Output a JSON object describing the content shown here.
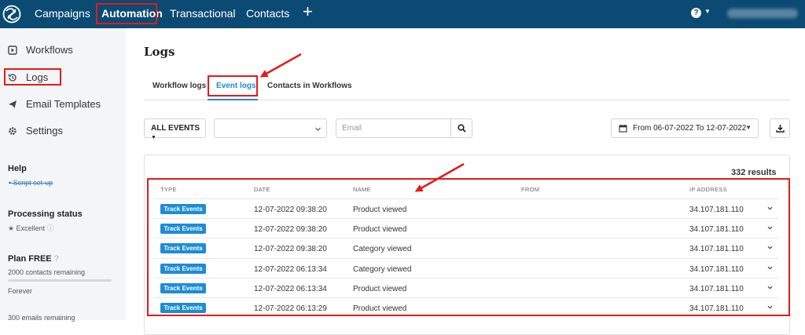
{
  "topnav": {
    "items": [
      {
        "label": "Campaigns",
        "active": false
      },
      {
        "label": "Automation",
        "active": true
      },
      {
        "label": "Transactional",
        "active": false
      },
      {
        "label": "Contacts",
        "active": false
      }
    ],
    "add_icon": "plus-icon",
    "help_icon": "?"
  },
  "sidebar": {
    "items": [
      {
        "label": "Workflows",
        "icon": "play-square-icon"
      },
      {
        "label": "Logs",
        "icon": "history-icon"
      },
      {
        "label": "Email Templates",
        "icon": "paper-plane-icon"
      },
      {
        "label": "Settings",
        "icon": "gear-icon"
      }
    ],
    "help_title": "Help",
    "help_link": "Script set-up",
    "processing_title": "Processing status",
    "processing_value": "Excellent",
    "plan_title": "Plan FREE",
    "contacts_remaining": "2000 contacts remaining",
    "contacts_used_fraction": 0.0,
    "plan_period": "Forever",
    "emails_remaining": "300 emails remaining"
  },
  "main": {
    "title": "Logs",
    "tabs": [
      {
        "label": "Workflow logs",
        "active": false
      },
      {
        "label": "Event logs",
        "active": true
      },
      {
        "label": "Contacts in Workflows",
        "active": false
      }
    ],
    "filters": {
      "events_label": "ALL EVENTS",
      "select_value": "",
      "email_placeholder": "Email",
      "date_range": "From 06-07-2022 To 12-07-2022"
    },
    "results_count": "332 results",
    "columns": [
      "TYPE",
      "DATE",
      "NAME",
      "FROM",
      "IP ADDRESS"
    ],
    "rows": [
      {
        "type": "Track Events",
        "date": "12-07-2022 09:38:20",
        "name": "Product viewed",
        "from": "",
        "ip": "34.107.181.110"
      },
      {
        "type": "Track Events",
        "date": "12-07-2022 09:38:20",
        "name": "Product viewed",
        "from": "",
        "ip": "34.107.181.110"
      },
      {
        "type": "Track Events",
        "date": "12-07-2022 09:38:20",
        "name": "Category viewed",
        "from": "",
        "ip": "34.107.181.110"
      },
      {
        "type": "Track Events",
        "date": "12-07-2022 06:13:34",
        "name": "Category viewed",
        "from": "",
        "ip": "34.107.181.110"
      },
      {
        "type": "Track Events",
        "date": "12-07-2022 06:13:34",
        "name": "Product viewed",
        "from": "",
        "ip": "34.107.181.110"
      },
      {
        "type": "Track Events",
        "date": "12-07-2022 06:13:29",
        "name": "Product viewed",
        "from": "",
        "ip": "34.107.181.110"
      }
    ]
  },
  "colors": {
    "nav_bg": "#0b4a73",
    "accent": "#1d8cd6",
    "annotation": "#e21b1b"
  }
}
